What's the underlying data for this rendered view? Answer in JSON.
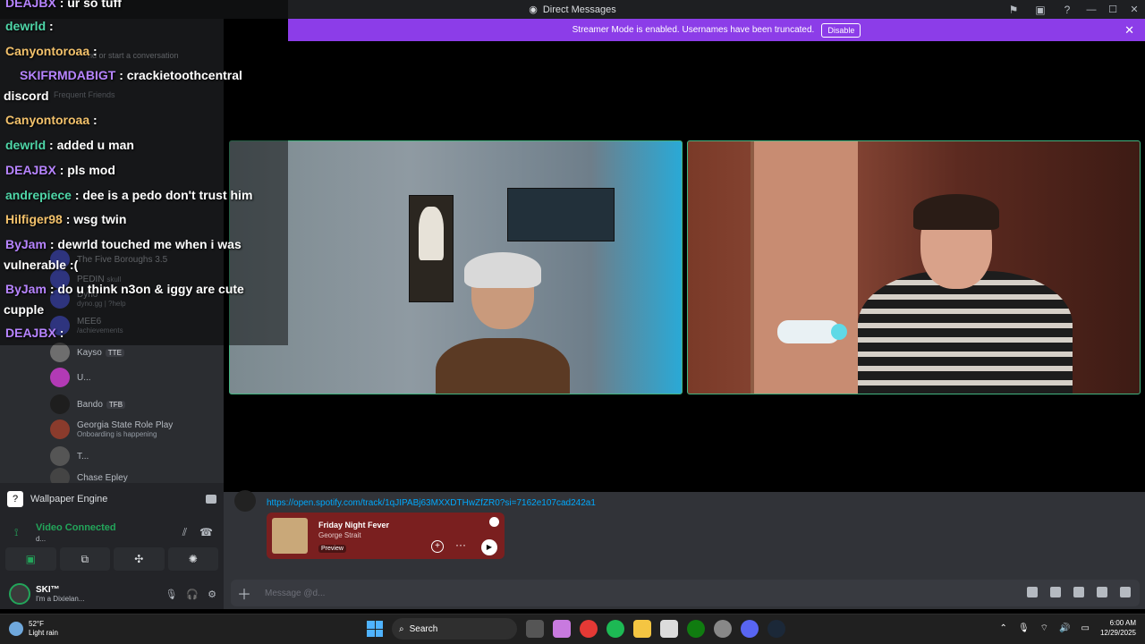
{
  "window": {
    "title": "Direct Messages",
    "controls": [
      "inbox-icon",
      "window-icon",
      "help-icon"
    ]
  },
  "banner": {
    "text": "Streamer Mode is enabled. Usernames have been truncated.",
    "button": "Disable"
  },
  "sidebar": {
    "conversation_hint": "nd or start a conversation",
    "frequent_friends": "Frequent Friends",
    "dms": [
      {
        "name": "The Five Boroughs 3.5",
        "sub": ""
      },
      {
        "name": "PEDIN",
        "sub": "skull"
      },
      {
        "name": "Dyno",
        "sub": "dyno.gg | ?help"
      },
      {
        "name": "MEE6",
        "sub": "/achievements"
      },
      {
        "name": "Kayso",
        "tag": "TTE"
      },
      {
        "name": "U...",
        "sub": ""
      },
      {
        "name": "Bando",
        "tag": "TFB"
      },
      {
        "name": "Georgia State Role Play",
        "sub": "Onboarding is happening"
      },
      {
        "name": "T...",
        "sub": ""
      },
      {
        "name": "Chase Epley",
        "sub": ""
      }
    ]
  },
  "chat": [
    {
      "user": "DEAJBX",
      "color": "#b784ff",
      "text": ": ur so tuff"
    },
    {
      "user": "dewrld",
      "color": "#4fd6a8",
      "text": ":"
    },
    {
      "user": "Canyontoroaa",
      "color": "#f2c16b",
      "text": ":"
    },
    {
      "user": "SKIFRMDABIGT",
      "color": "#b784ff",
      "text": ": crackietoothcentral discord"
    },
    {
      "user": "Canyontoroaa",
      "color": "#f2c16b",
      "text": ":"
    },
    {
      "user": "dewrld",
      "color": "#4fd6a8",
      "text": ": added u man"
    },
    {
      "user": "DEAJBX",
      "color": "#b784ff",
      "text": ": pls mod"
    },
    {
      "user": "andrepiece",
      "color": "#4fd6a8",
      "text": ": dee is a pedo don't trust him"
    },
    {
      "user": "Hilfiger98",
      "color": "#f2c16b",
      "text": ": wsg twin"
    },
    {
      "user": "ByJam",
      "color": "#b784ff",
      "text": ": dewrld touched me when i was vulnerable :("
    },
    {
      "user": "ByJam",
      "color": "#b784ff",
      "text": ": do u think n3on & iggy are cute cupple"
    },
    {
      "user": "DEAJBX",
      "color": "#b784ff",
      "text": ":"
    }
  ],
  "message": {
    "link": "https://open.spotify.com/track/1qJIPABj63MXXDTHwZfZR0?si=7162e107cad242a1",
    "spotify": {
      "title": "Friday Night Fever",
      "artist": "George Strait",
      "badge": "Preview"
    }
  },
  "composer": {
    "placeholder": "Message @d..."
  },
  "voice": {
    "activity": "Wallpaper Engine",
    "status": "Video Connected",
    "sub": "d..."
  },
  "user": {
    "name": "SKI™",
    "status": "I'm a Dixielan..."
  },
  "taskbar": {
    "temp": "52°F",
    "condition": "Light rain",
    "search": "Search",
    "time": "6:00 AM",
    "date": "12/29/2025"
  }
}
